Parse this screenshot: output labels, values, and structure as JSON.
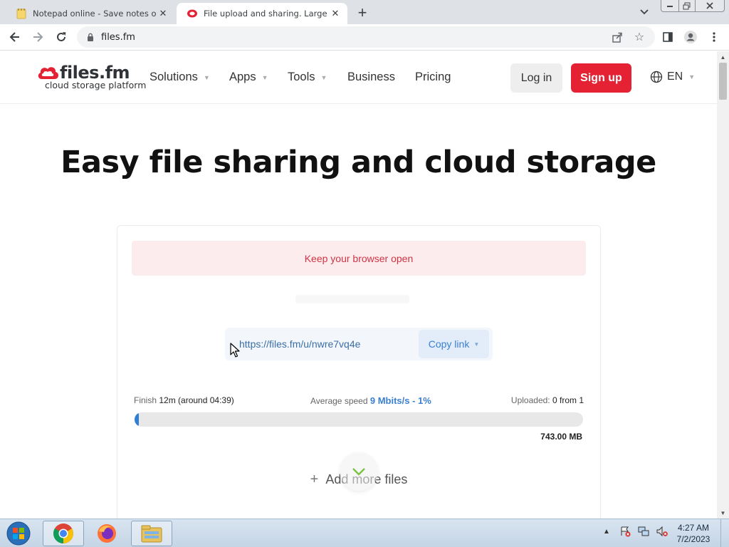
{
  "browser": {
    "tabs": [
      {
        "title": "Notepad online - Save notes onl",
        "favicon": "notepad-favicon",
        "active": false
      },
      {
        "title": "File upload and sharing. Large fil",
        "favicon": "filesfm-favicon",
        "active": true
      }
    ],
    "address": "files.fm",
    "icons": [
      "back-icon",
      "forward-icon",
      "reload-icon",
      "lock-icon",
      "share-icon",
      "star-icon",
      "sidepanel-icon",
      "profile-icon",
      "menu-icon",
      "tab-search-icon"
    ]
  },
  "site": {
    "logo": {
      "name": "files.fm",
      "tagline": "cloud storage platform"
    },
    "nav": [
      "Solutions",
      "Apps",
      "Tools",
      "Business",
      "Pricing"
    ],
    "login": "Log in",
    "signup": "Sign up",
    "language": "EN",
    "hero_title": "Easy file sharing and cloud storage"
  },
  "upload": {
    "alert": "Keep your browser open",
    "share_url": "https://files.fm/u/nwre7vq4e",
    "copy_label": "Copy link",
    "finish_label": "Finish",
    "finish_value": "12m (around 04:39)",
    "avg_label": "Average speed",
    "avg_value": "9 Mbits/s - 1%",
    "uploaded_label": "Uploaded:",
    "uploaded_value": "0 from 1",
    "progress_fraction": 0.01,
    "total_size": "743.00 MB",
    "add_more": "Add more files"
  },
  "colors": {
    "brand_red": "#e52233",
    "link_blue": "#3a7fd0",
    "alert_bg": "#fdecee",
    "alert_text": "#cf3443"
  },
  "taskbar": {
    "apps": [
      "chrome-icon",
      "firefox-icon",
      "explorer-icon"
    ],
    "time": "4:27 AM",
    "date": "7/2/2023"
  }
}
